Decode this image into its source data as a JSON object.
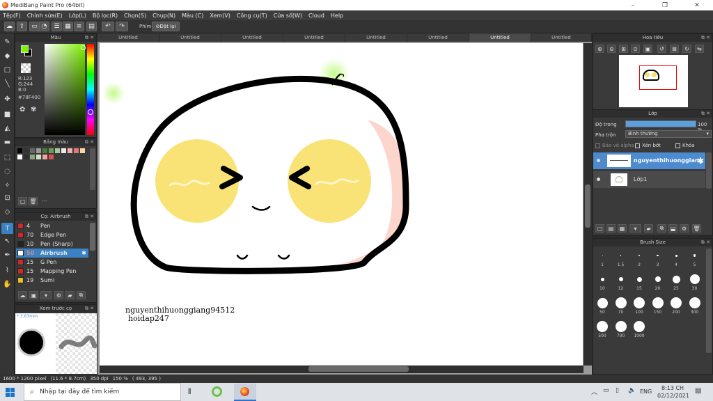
{
  "window": {
    "title": "MediBang Paint Pro (64bit)",
    "minimize": "–",
    "maximize": "❐",
    "close": "✕"
  },
  "menu": [
    "Tệp(F)",
    "Chỉnh sửa(E)",
    "Lớp(L)",
    "Bộ lọc(R)",
    "Chọn(S)",
    "Chụp(N)",
    "Màu (C)",
    "Xem(V)",
    "Công cụ(T)",
    "Cửa sổ(W)",
    "Cloud",
    "Help"
  ],
  "toolbar": {
    "shortcut_label": "Phím",
    "reset_label": "Đặt lại"
  },
  "color_panel": {
    "title": "Màu",
    "r": "R:123",
    "g": "G:244",
    "b": "B:0",
    "hex": "#78F400",
    "main_color": "#7cf400"
  },
  "palette_panel": {
    "title": "Bảng màu",
    "name_placeholder": "---",
    "swatches": [
      "#000000",
      "#333333",
      "#666666",
      "#999999",
      "#4a7c3b",
      "#6d9c5a",
      "#a9c79a",
      "#e8e8e8",
      "#f0b0b0",
      "#e07a7a",
      "#f6d7a5",
      "#ffffff",
      "#2d2d2d",
      "#8aa87a",
      "#cfe0c0",
      "#f2a0a0",
      "#d85050"
    ]
  },
  "brush_panel": {
    "title": "Cọ: Airbrush",
    "brushes": [
      {
        "size": "4",
        "name": "Pen",
        "color": "#cc2a2a"
      },
      {
        "size": "70",
        "name": "Edge Pen",
        "color": "#cc2a2a"
      },
      {
        "size": "10",
        "name": "Pen (Sharp)",
        "color": "#222222"
      },
      {
        "size": "50",
        "name": "Airbrush",
        "color": "#ffffff"
      },
      {
        "size": "15",
        "name": "G Pen",
        "color": "#cc2a2a"
      },
      {
        "size": "15",
        "name": "Mapping Pen",
        "color": "#cc2a2a"
      },
      {
        "size": "19",
        "name": "Sumi",
        "color": "#e8c020"
      }
    ]
  },
  "preview_panel": {
    "title": "Xem trước cọ",
    "size": "3.63mm"
  },
  "tabs": [
    "Untitled",
    "Untitled",
    "Untitled",
    "Untitled",
    "Untitled",
    "Untitled",
    "Untitled",
    "Untitled"
  ],
  "watermark": {
    "line1": "nguyenthihuonggiang94512",
    "line2": "hoidap247"
  },
  "nav_panel": {
    "title": "Hoa tiêu"
  },
  "layer_panel": {
    "title": "Lớp",
    "opacity_label": "Độ trong",
    "opacity_value": "100 %",
    "opacity_fraction": 1.0,
    "blend_label": "Pha trộn",
    "blend_value": "Bình thường",
    "protect_alpha": "Bảo vệ alpha",
    "clipping": "Xén bớt",
    "lock": "Khóa",
    "layers": [
      {
        "name": "nguyenthihuonggiang"
      },
      {
        "name": "Lớp1"
      }
    ]
  },
  "size_panel": {
    "title": "Brush Size",
    "sizes": [
      "1",
      "1.5",
      "2",
      "3",
      "4",
      "5",
      "10",
      "12",
      "15",
      "20",
      "25",
      "30",
      "50",
      "70",
      "100",
      "150",
      "200",
      "300",
      "500",
      "700",
      "1000"
    ]
  },
  "status": {
    "dims": "1600 * 1200 pixel",
    "phys": "(11.6 * 8.7cm)",
    "dpi": "350 dpi",
    "zoom": "150 %",
    "coord": "( 493, 395 )"
  },
  "taskbar": {
    "search_placeholder": "Nhập tại đây để tìm kiếm",
    "lang": "ENG",
    "time": "8:13 CH",
    "date": "02/12/2021"
  }
}
